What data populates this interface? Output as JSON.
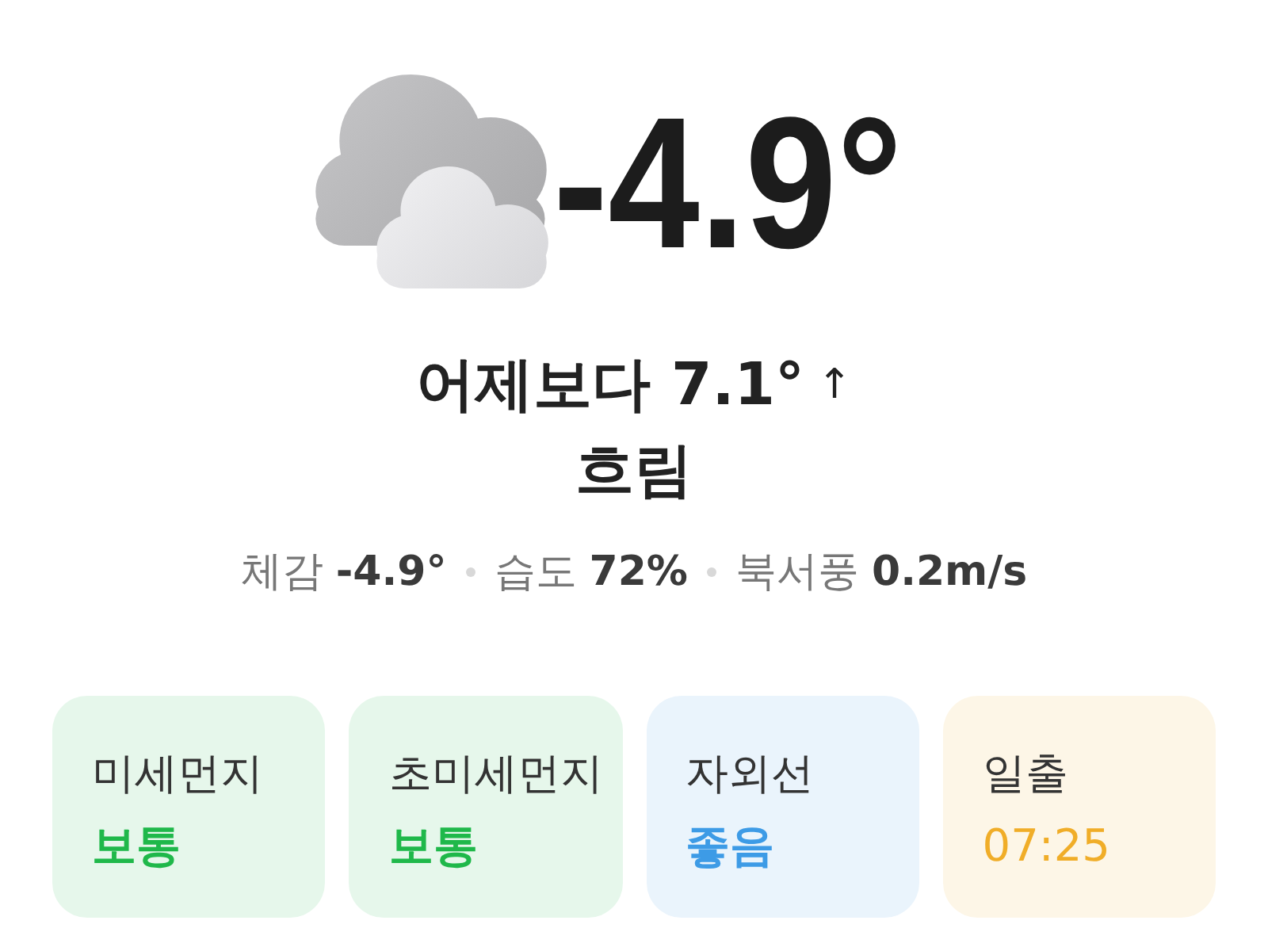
{
  "current": {
    "temperature": "-4.9°",
    "comparison": "어제보다 7.1°",
    "trend_arrow": "↑",
    "condition": "흐림"
  },
  "details": [
    {
      "label": "체감",
      "value": "-4.9°"
    },
    {
      "label": "습도",
      "value": "72%"
    },
    {
      "label": "북서풍",
      "value": "0.2m/s"
    }
  ],
  "cards": [
    {
      "kind": "grade",
      "label": "미세먼지",
      "value": "보통",
      "color": "#1fb84a"
    },
    {
      "kind": "grade",
      "label": "초미세먼지",
      "value": "보통",
      "color": "#1fb84a"
    },
    {
      "kind": "grade",
      "label": "자외선",
      "value": "좋음",
      "color": "#3d9be6"
    },
    {
      "kind": "time",
      "label": "일출",
      "value": "07:25",
      "color": "#f0ad28"
    }
  ]
}
